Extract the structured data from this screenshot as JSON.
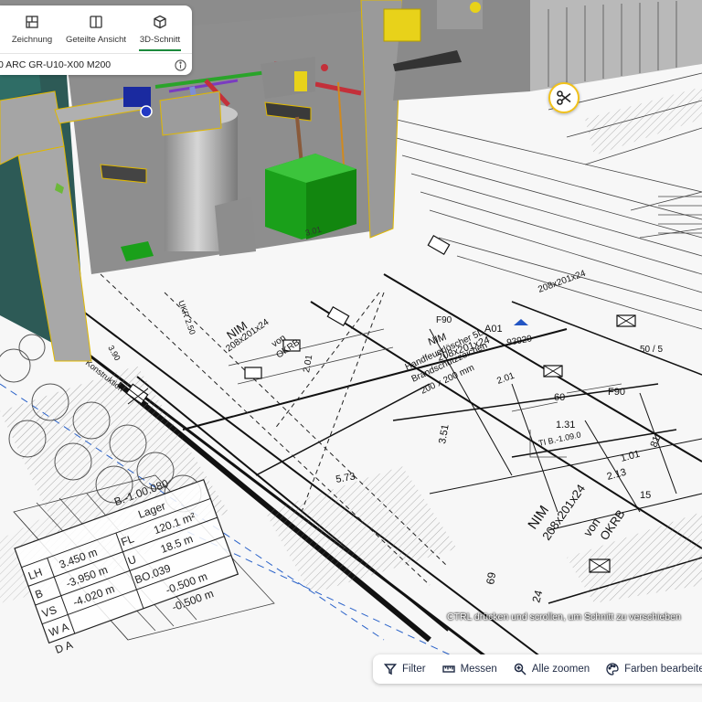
{
  "view_tabs": [
    {
      "label": "Zeichnung",
      "icon": "drawing-icon"
    },
    {
      "label": "Geteilte Ansicht",
      "icon": "split-view-icon"
    },
    {
      "label": "3D-Schnitt",
      "icon": "cube-icon",
      "active": true
    }
  ],
  "model": {
    "name": "0 ARC GR-U10-X00 M200",
    "info_icon": "info-icon"
  },
  "cut_tool": {
    "icon": "scissors-icon"
  },
  "hint_text": "CTRL drücken und scrollen, um Schnitt zu verschieben",
  "toolbar": {
    "filter": "Filter",
    "measure": "Messen",
    "zoom_all": "Alle zoomen",
    "edit_colors": "Farben bearbeiten"
  },
  "drawing_labels": {
    "lager": "Lager",
    "b_code": "B.-1.00.080",
    "fl": "FL",
    "area": "120.1 m²",
    "u": "U",
    "perim": "18.5 m",
    "lh": "LH",
    "lh_val": "3.450 m",
    "b": "B",
    "b_val": "-3.950 m",
    "vs": "VS",
    "vs_val": "-4.020 m",
    "bo": "BO.039",
    "wa": "W A",
    "da": "D A",
    "neg500a": "-0.500 m",
    "neg500b": "-0.500 m",
    "nim1": "NIM",
    "nim1_dim": "208x201x24",
    "nim1_lvl": "2.01",
    "von": "von",
    "okrb": "OKRB",
    "nim2": "NIM",
    "nim2_dim": "208x201x24",
    "nim2_lvl": "2.01",
    "nim3": "NIM",
    "nim3_dim": "208x201x24",
    "a01": "A01",
    "a01_num": "93920",
    "f90a": "F90",
    "f90b": "F90",
    "handfeuer": "Handfeuerlöscher 5L",
    "brandschutz": "Brandschutzzeichen",
    "brandschutz_dim": "200 x 200 mm",
    "d351": "3.51",
    "d573": "5.73",
    "d131": "1.31",
    "d101": "1.01",
    "d213": "2.13",
    "d60": "60",
    "d69": "69",
    "d24": "24",
    "d81": "81",
    "d15": "15",
    "d390": "3.90",
    "d201": "2.01",
    "d3": "3.01",
    "d50": "50 / 5",
    "konstruktion": "Konstruktion",
    "ukr": "UKR 2.50",
    "tb": "TI B.-1.09.0"
  }
}
